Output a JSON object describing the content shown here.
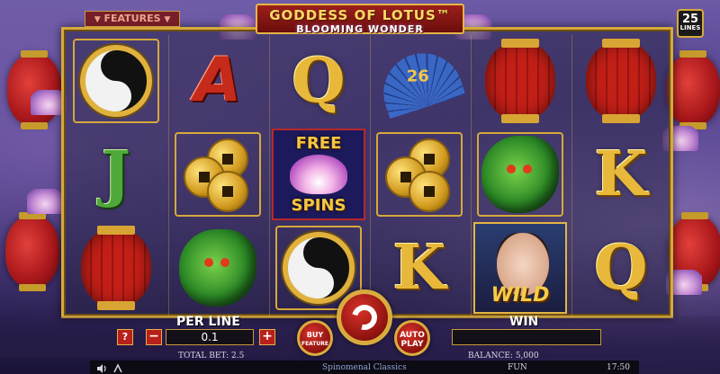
{
  "header": {
    "title": "GODDESS OF LOTUS™",
    "subtitle": "BLOOMING WONDER",
    "features_label": "FEATURES",
    "lines_count": "25",
    "lines_label": "LINES"
  },
  "reels": {
    "columns": [
      {
        "symbols": [
          "yin-yang",
          "J",
          "lantern"
        ]
      },
      {
        "symbols": [
          "A",
          "coins",
          "dragon"
        ]
      },
      {
        "symbols": [
          "Q",
          "free-spins",
          "yin-yang"
        ]
      },
      {
        "symbols": [
          "fan",
          "coins",
          "K"
        ]
      },
      {
        "symbols": [
          "lantern",
          "dragon",
          "wild"
        ]
      },
      {
        "symbols": [
          "lantern",
          "K",
          "Q"
        ]
      }
    ],
    "letters": {
      "col0_row1": "J",
      "col1_row0": "A",
      "col2_row0": "Q",
      "col3_row2": "K",
      "col5_row1": "K",
      "col5_row2": "Q"
    },
    "fan_text": "26",
    "free_spins_top": "FREE",
    "free_spins_bottom": "SPINS",
    "wild_text": "WILD"
  },
  "controls": {
    "help_label": "?",
    "minus_label": "−",
    "plus_label": "+",
    "per_line_label": "PER LINE",
    "per_line_value": "0.1",
    "buy_label_1": "BUY",
    "buy_label_2": "FEATURE",
    "autoplay_label_1": "AUTO",
    "autoplay_label_2": "PLAY",
    "win_label": "WIN",
    "win_value": ""
  },
  "status": {
    "total_bet": "TOTAL BET: 2.5",
    "balance": "BALANCE: 5,000",
    "provider": "Spinomenal Classics",
    "mode": "FUN",
    "clock": "17:50"
  },
  "colors": {
    "gold": "#d6a93a",
    "red": "#b8201a",
    "purple_bg": "#4a3a86"
  },
  "icons": [
    "sound-icon",
    "speed-icon",
    "spin-icon",
    "help-icon"
  ]
}
